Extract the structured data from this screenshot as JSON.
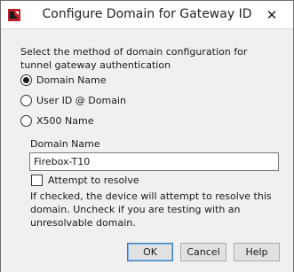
{
  "window": {
    "title": "Configure Domain for Gateway ID",
    "close_glyph": "✕"
  },
  "form": {
    "prompt": "Select the method of domain configuration for tunnel gateway authentication",
    "options": [
      {
        "label": "Domain Name",
        "checked": true
      },
      {
        "label": "User ID @ Domain",
        "checked": false
      },
      {
        "label": "X500 Name",
        "checked": false
      }
    ],
    "domain_name_label": "Domain Name",
    "domain_name_value": "Firebox-T10",
    "resolve_label": "Attempt to resolve",
    "resolve_checked": false,
    "help_text": "If checked, the device will attempt to resolve this domain. Uncheck if you are testing with an unresolvable domain."
  },
  "buttons": {
    "ok": "OK",
    "cancel": "Cancel",
    "help": "Help"
  },
  "colors": {
    "dialog_background": "#f0f0f0",
    "title_background": "#ffffff",
    "default_button_border": "#3c7fb1"
  },
  "icons": {
    "app": "watchguard-logo-icon",
    "close": "close-icon"
  }
}
